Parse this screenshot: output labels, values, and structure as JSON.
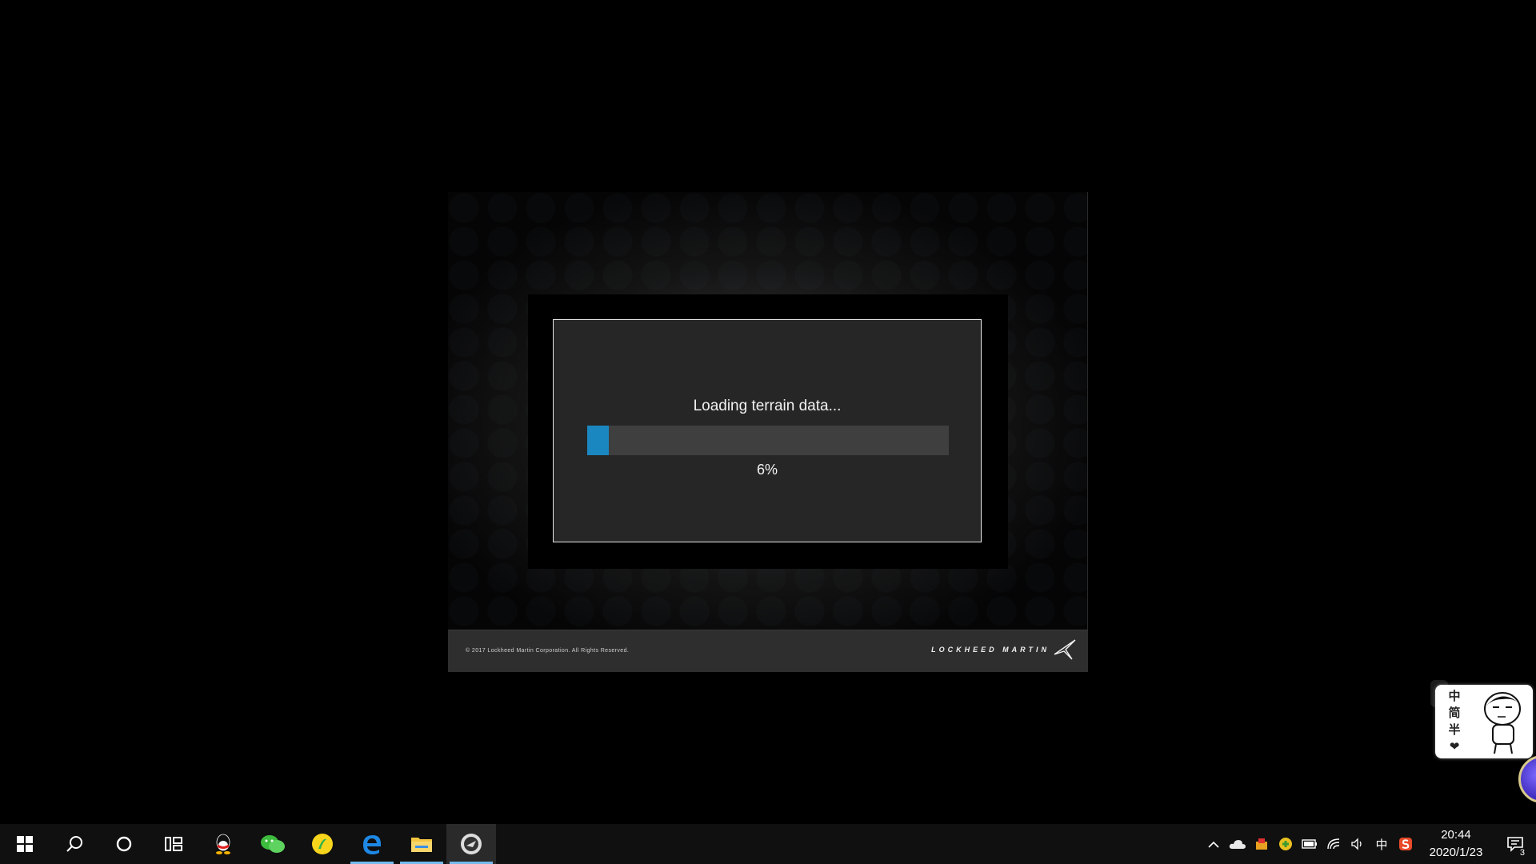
{
  "splash": {
    "status_text": "Loading terrain data...",
    "progress_percent_label": "6%",
    "progress_value": 0.06,
    "copyright": "© 2017 Lockheed Martin Corporation. All Rights Reserved.",
    "brand": "LOCKHEED MARTIN",
    "accent_color": "#1b87c0"
  },
  "ime_widget": {
    "chars": [
      "中",
      "简",
      "半",
      "❤"
    ]
  },
  "taskbar": {
    "apps": [
      {
        "name": "start-button-icon"
      },
      {
        "name": "search-icon"
      },
      {
        "name": "cortana-icon"
      },
      {
        "name": "task-view-icon"
      },
      {
        "name": "qq-icon"
      },
      {
        "name": "wechat-icon"
      },
      {
        "name": "qq-music-icon"
      },
      {
        "name": "edge-icon"
      },
      {
        "name": "file-explorer-icon"
      },
      {
        "name": "simulator-app-icon"
      }
    ],
    "tray": {
      "ime_indicator": "中",
      "time": "20:44",
      "date": "2020/1/23",
      "notification_count": "3"
    }
  }
}
